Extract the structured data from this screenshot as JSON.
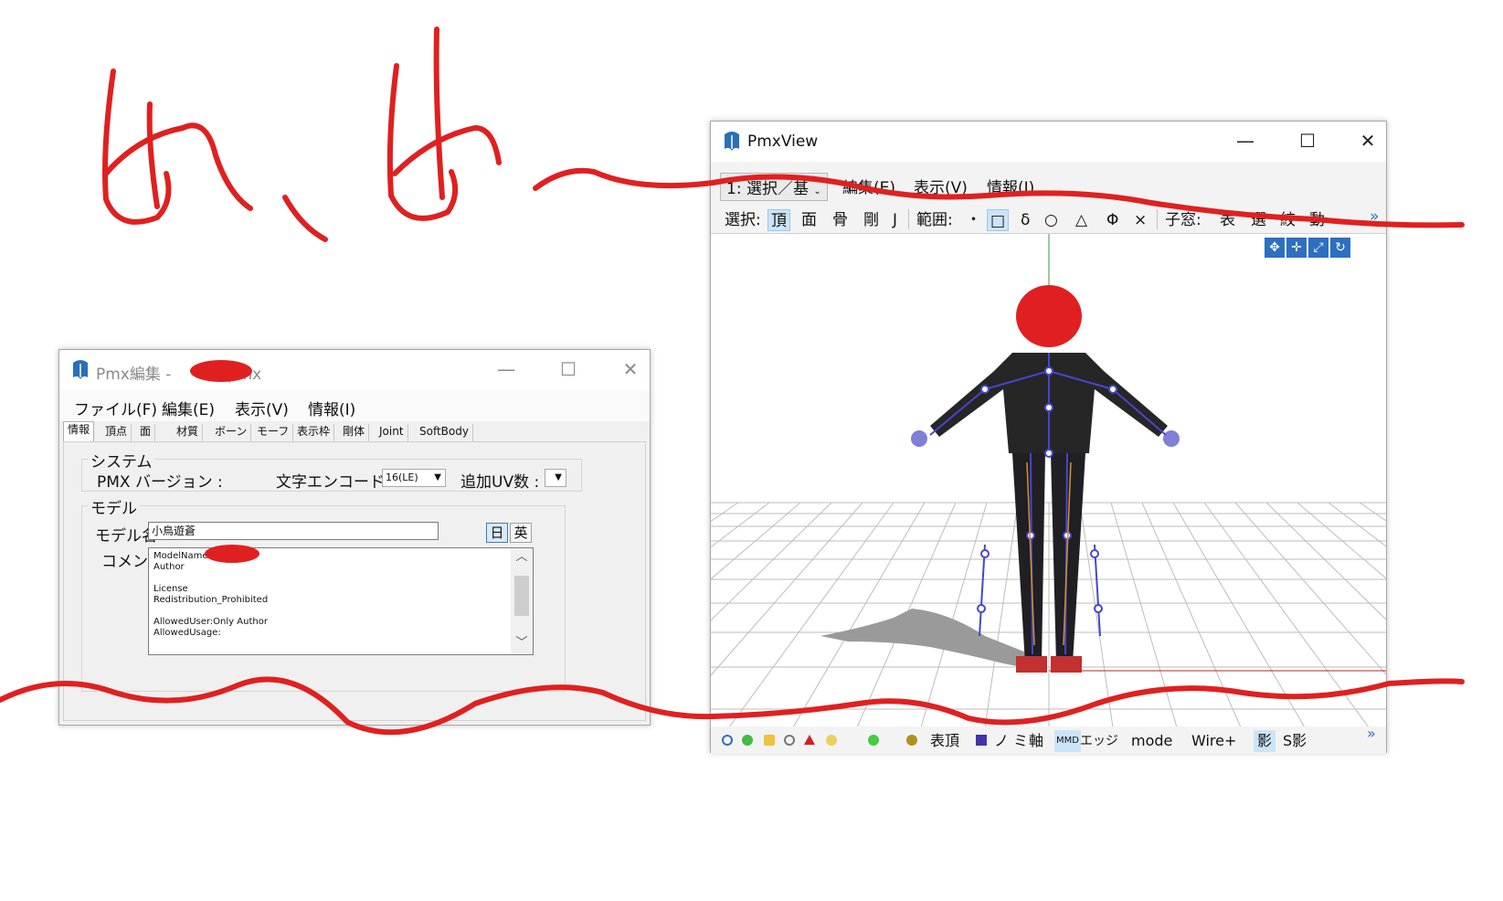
{
  "editor": {
    "title_prefix": "Pmx編集 - ",
    "title_suffix": "pmx",
    "menus": [
      "ファイル(F)",
      "編集(E)",
      "表示(V)",
      "情報(I)"
    ],
    "tabs": [
      "情報",
      "頂点",
      "面",
      "材質",
      "ボーン",
      "モーフ",
      "表示枠",
      "剛体",
      "Joint",
      "SoftBody"
    ],
    "system_group": "システム",
    "pmx_version_label": "PMX バージョン :",
    "encoding_label": "文字エンコード :",
    "encoding_value": "16(LE)",
    "uv_label": "追加UV数 :",
    "model_group": "モデル",
    "model_name_label": "モデル名",
    "model_name_value": "小鳥遊蒼",
    "lang_jp": "日",
    "lang_en": "英",
    "comment_label": "コメント",
    "comment_lines": [
      "ModelName",
      "Author",
      "",
      "License",
      "Redistribution_Prohibited",
      "",
      "AllowedUser:Only Author",
      "AllowedUsage:"
    ]
  },
  "viewer": {
    "title": "PmxView",
    "menus": [
      "1: 選択／基",
      "編集(E)",
      "表示(V)",
      "情報(I)"
    ],
    "toolbar": {
      "select_label": "選択:",
      "select_items": [
        "頂",
        "面",
        "骨",
        "剛",
        "J"
      ],
      "range_label": "範囲:",
      "range_items": [
        "・",
        "□",
        "δ",
        "○",
        "△",
        "Φ",
        "×"
      ],
      "child_label": "子窓:",
      "child_items": [
        "表",
        "選",
        "絞",
        "動"
      ],
      "overflow": "»"
    },
    "statusbar": {
      "items": [
        "表頂",
        "ノ ミ",
        "軸",
        "MMD",
        "エッジ",
        "mode",
        "Wire+",
        "影",
        "S影"
      ],
      "overflow": "»"
    }
  },
  "handwriting": "出、出～",
  "colors": {
    "scribble": "#e02020",
    "select_highlight": "#cce4f7",
    "bone": "#4444cc",
    "grid": "#bbbbbb"
  }
}
